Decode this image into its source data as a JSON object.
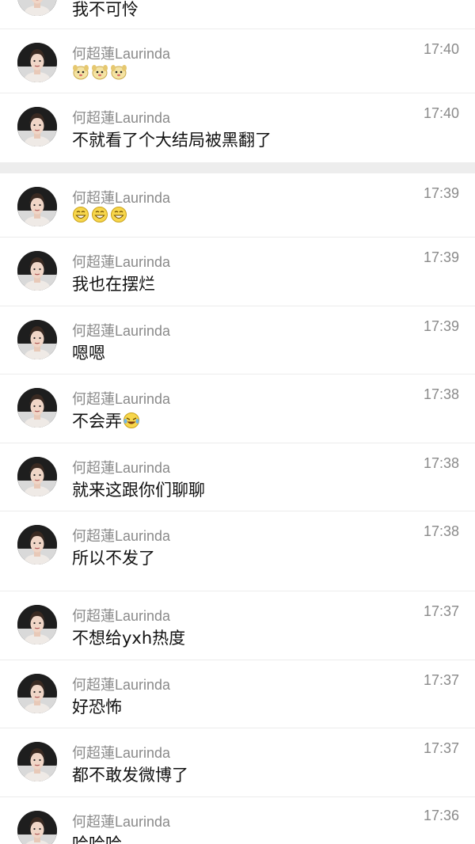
{
  "contact": {
    "name": "何超蓮Laurinda"
  },
  "messages": [
    {
      "text": "我不可怜",
      "time": ""
    },
    {
      "text": "",
      "time": "17:40",
      "emoji": "dog-face-emoji x3"
    },
    {
      "text": "不就看了个大结局被黑翻了",
      "time": "17:40"
    },
    {
      "text": "",
      "time": "17:39",
      "emoji": "grin-face-emoji x3"
    },
    {
      "text": "我也在摆烂",
      "time": "17:39"
    },
    {
      "text": "嗯嗯",
      "time": "17:39"
    },
    {
      "text": "不会弄",
      "time": "17:38",
      "emoji": "laugh-cry-emoji"
    },
    {
      "text": "就来这跟你们聊聊",
      "time": "17:38"
    },
    {
      "text": "所以不发了",
      "time": "17:38"
    },
    {
      "text": "不想给yxh热度",
      "time": "17:37"
    },
    {
      "text": "好恐怖",
      "time": "17:37"
    },
    {
      "text": "都不敢发微博了",
      "time": "17:37"
    },
    {
      "text": "哈哈哈",
      "time": "17:36"
    }
  ],
  "colors": {
    "meta": "#8a8a8a",
    "text": "#111111",
    "divider": "#ececec",
    "band": "#ededed"
  }
}
